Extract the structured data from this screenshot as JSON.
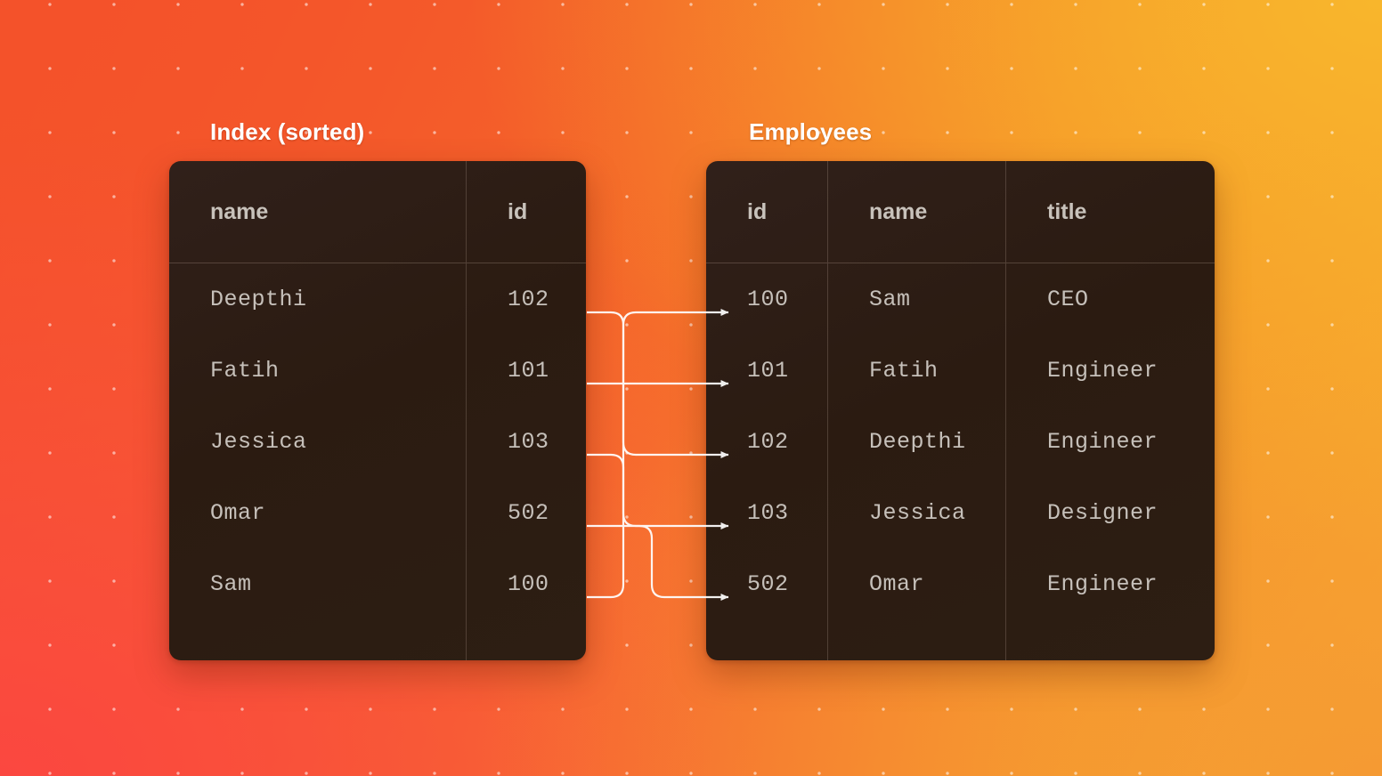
{
  "background": {
    "gradient_from": "#f4522a",
    "gradient_to": "#f7ad2d",
    "accent_red": "#fb4740",
    "accent_yellow": "#f8b62c",
    "dot_color": "#ffffff"
  },
  "theme": {
    "panel_bg": "#2b1b11",
    "panel_border": "#d6c0b0",
    "text_color": "#c9c3bd",
    "title_color": "#ffffff",
    "connector_color": "#ffffff"
  },
  "index_panel": {
    "title": "Index (sorted)",
    "columns": [
      "name",
      "id"
    ],
    "rows": [
      {
        "name": "Deepthi",
        "id": "102"
      },
      {
        "name": "Fatih",
        "id": "101"
      },
      {
        "name": "Jessica",
        "id": "103"
      },
      {
        "name": "Omar",
        "id": "502"
      },
      {
        "name": "Sam",
        "id": "100"
      }
    ]
  },
  "employees_panel": {
    "title": "Employees",
    "columns": [
      "id",
      "name",
      "title"
    ],
    "rows": [
      {
        "id": "100",
        "name": "Sam",
        "title": "CEO"
      },
      {
        "id": "101",
        "name": "Fatih",
        "title": "Engineer"
      },
      {
        "id": "102",
        "name": "Deepthi",
        "title": "Engineer"
      },
      {
        "id": "103",
        "name": "Jessica",
        "title": "Designer"
      },
      {
        "id": "502",
        "name": "Omar",
        "title": "Engineer"
      }
    ]
  },
  "connectors": [
    {
      "from_row": 0,
      "from_id": "102",
      "to_row": 2,
      "to_id": "102"
    },
    {
      "from_row": 1,
      "from_id": "101",
      "to_row": 1,
      "to_id": "101"
    },
    {
      "from_row": 2,
      "from_id": "103",
      "to_row": 3,
      "to_id": "103"
    },
    {
      "from_row": 3,
      "from_id": "502",
      "to_row": 4,
      "to_id": "502"
    },
    {
      "from_row": 4,
      "from_id": "100",
      "to_row": 0,
      "to_id": "100"
    }
  ]
}
